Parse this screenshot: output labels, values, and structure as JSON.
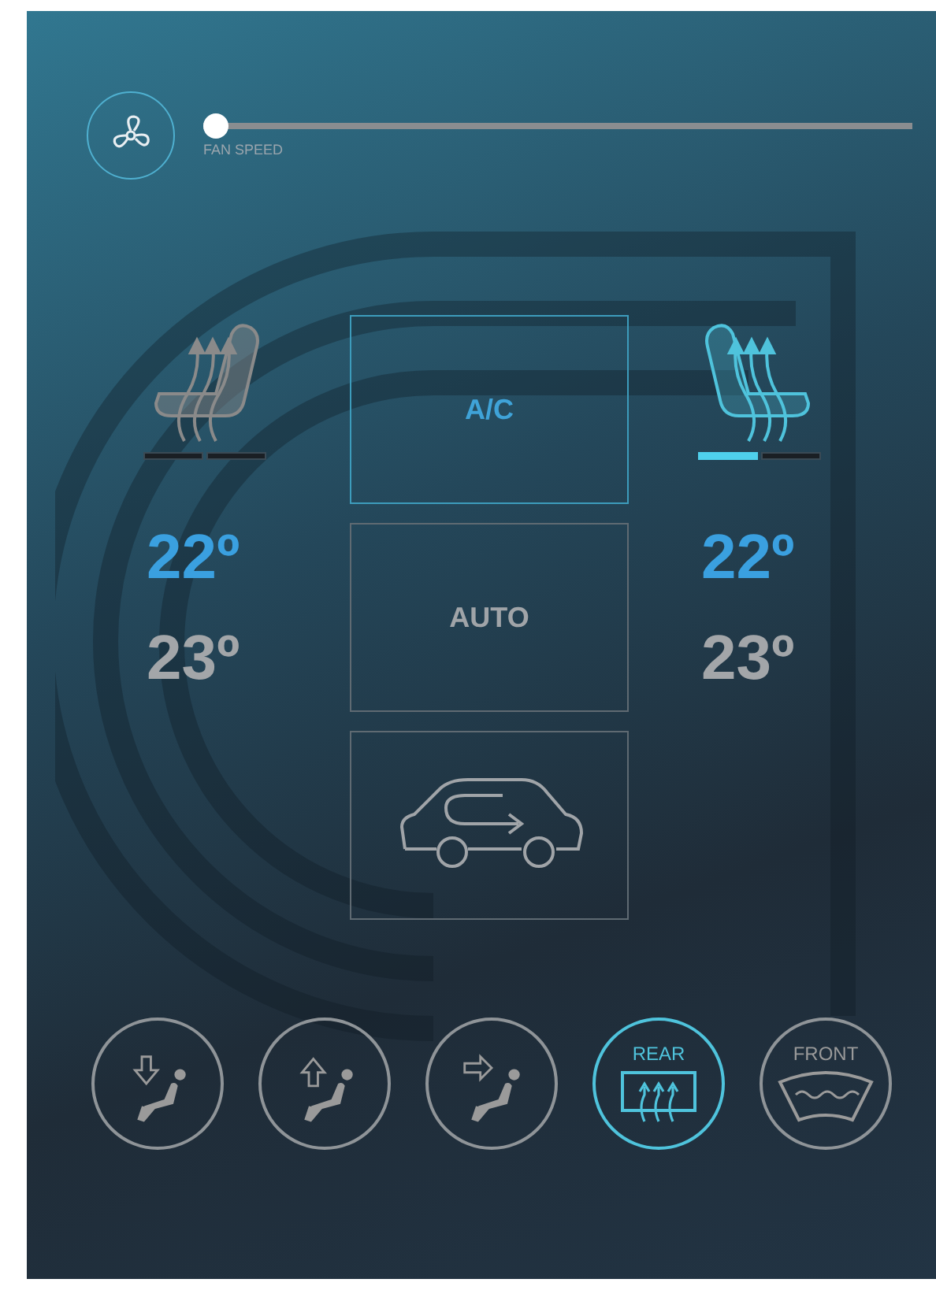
{
  "fan": {
    "label": "FAN SPEED",
    "level": 0.0
  },
  "seats": [
    {
      "kind": "plain",
      "on": false,
      "segments": [
        {
          "on": false
        },
        {
          "on": false
        }
      ],
      "temperatures": [
        {
          "value": "22º",
          "selected": true
        },
        {
          "value": "23º",
          "selected": false
        }
      ]
    },
    {
      "kind": "mirrored",
      "on": true,
      "segments": [
        {
          "on": true
        },
        {
          "on": false
        }
      ],
      "temperatures": [
        {
          "value": "22º",
          "selected": true
        },
        {
          "value": "23º",
          "selected": false
        }
      ]
    }
  ],
  "modes": [
    {
      "kind": "text",
      "label": "A/C",
      "on": true
    },
    {
      "kind": "text",
      "label": "AUTO",
      "on": false
    },
    {
      "kind": "recirculation",
      "on": false
    }
  ],
  "airflow": [
    {
      "kind": "vent-down",
      "on": false
    },
    {
      "kind": "vent-up",
      "on": false
    },
    {
      "kind": "vent-face",
      "on": false
    },
    {
      "kind": "rear-defrost",
      "label": "REAR",
      "on": true
    },
    {
      "kind": "front-defrost",
      "label": "FRONT",
      "on": false
    }
  ]
}
